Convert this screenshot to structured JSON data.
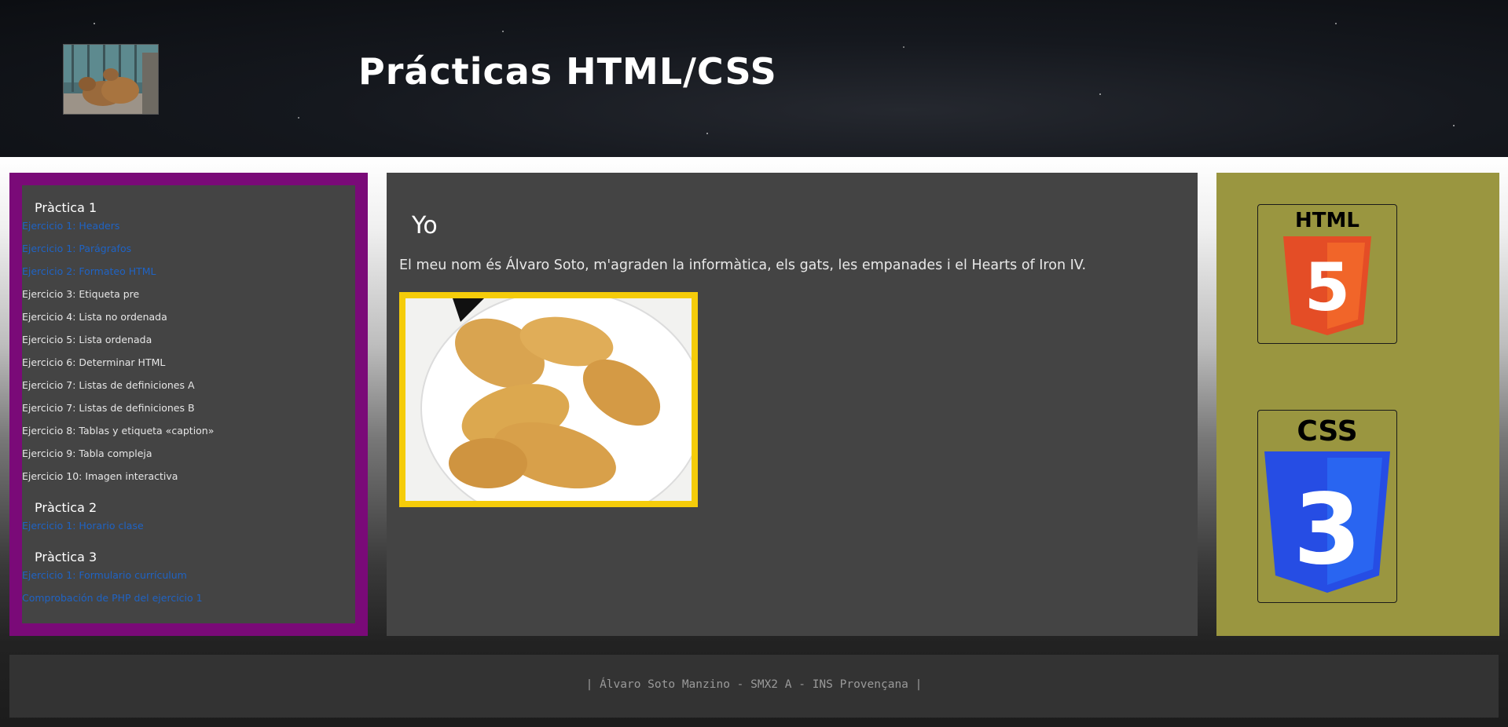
{
  "header": {
    "title": "Prácticas HTML/CSS",
    "logo_icon": "capybara-photo"
  },
  "nav": {
    "sections": [
      {
        "heading": "Pràctica 1",
        "items": [
          {
            "label": "Ejercicio 1: Headers",
            "link": true
          },
          {
            "label": "Ejercicio 1: Parágrafos",
            "link": true
          },
          {
            "label": "Ejercicio 2: Formateo HTML",
            "link": true
          },
          {
            "label": "Ejercicio 3: Etiqueta pre",
            "link": false
          },
          {
            "label": "Ejercicio 4: Lista no ordenada",
            "link": false
          },
          {
            "label": "Ejercicio 5: Lista ordenada",
            "link": false
          },
          {
            "label": "Ejercicio 6: Determinar HTML",
            "link": false
          },
          {
            "label": "Ejercicio 7: Listas de definiciones A",
            "link": false
          },
          {
            "label": "Ejercicio 7: Listas de definiciones B",
            "link": false
          },
          {
            "label": "Ejercicio 8: Tablas y etiqueta «caption»",
            "link": false
          },
          {
            "label": "Ejercicio 9: Tabla compleja",
            "link": false
          },
          {
            "label": "Ejercicio 10: Imagen interactiva",
            "link": false
          }
        ]
      },
      {
        "heading": "Pràctica 2",
        "items": [
          {
            "label": "Ejercicio 1: Horario clase",
            "link": true
          }
        ]
      },
      {
        "heading": "Pràctica 3",
        "items": [
          {
            "label": "Ejercicio 1: Formulario currículum",
            "link": true
          },
          {
            "label": "Comprobación de PHP del ejercicio 1",
            "link": true
          }
        ]
      }
    ]
  },
  "main": {
    "title": "Yo",
    "text": "El meu nom és Álvaro Soto, m'agraden la informàtica, els gats, les empanades i el Hearts of Iron IV.",
    "image_icon": "empanadas-photo"
  },
  "aside": {
    "html_badge": {
      "label": "HTML",
      "number": "5",
      "icon": "html5-logo-icon"
    },
    "css_badge": {
      "label": "CSS",
      "number": "3",
      "icon": "css3-logo-icon"
    }
  },
  "footer": {
    "text": "| Álvaro Soto Manzino - SMX2 A - INS Provençana |"
  },
  "colors": {
    "nav_border": "#7a0a78",
    "panel_bg": "#444444",
    "link": "#1f63c4",
    "photo_border": "#f5cc0a",
    "aside_bg": "#9a9640",
    "html_orange": "#e44d26",
    "css_blue": "#264de4"
  }
}
